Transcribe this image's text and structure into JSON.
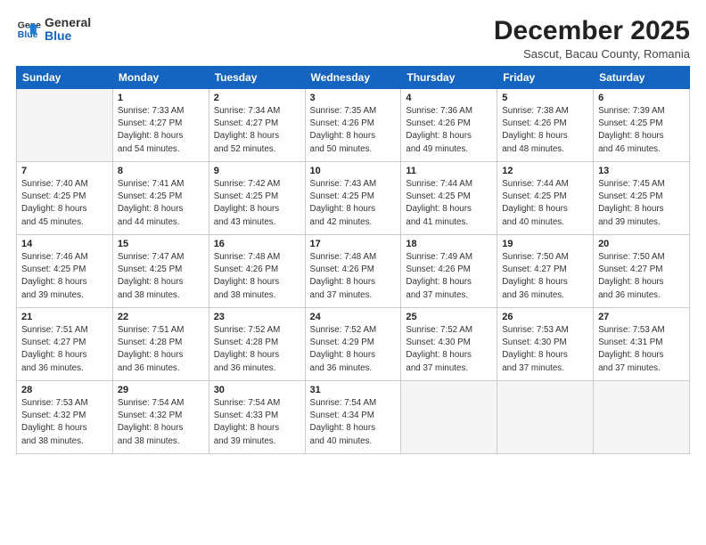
{
  "logo": {
    "line1": "General",
    "line2": "Blue"
  },
  "title": "December 2025",
  "subtitle": "Sascut, Bacau County, Romania",
  "weekdays": [
    "Sunday",
    "Monday",
    "Tuesday",
    "Wednesday",
    "Thursday",
    "Friday",
    "Saturday"
  ],
  "weeks": [
    [
      {
        "day": "",
        "info": ""
      },
      {
        "day": "1",
        "info": "Sunrise: 7:33 AM\nSunset: 4:27 PM\nDaylight: 8 hours\nand 54 minutes."
      },
      {
        "day": "2",
        "info": "Sunrise: 7:34 AM\nSunset: 4:27 PM\nDaylight: 8 hours\nand 52 minutes."
      },
      {
        "day": "3",
        "info": "Sunrise: 7:35 AM\nSunset: 4:26 PM\nDaylight: 8 hours\nand 50 minutes."
      },
      {
        "day": "4",
        "info": "Sunrise: 7:36 AM\nSunset: 4:26 PM\nDaylight: 8 hours\nand 49 minutes."
      },
      {
        "day": "5",
        "info": "Sunrise: 7:38 AM\nSunset: 4:26 PM\nDaylight: 8 hours\nand 48 minutes."
      },
      {
        "day": "6",
        "info": "Sunrise: 7:39 AM\nSunset: 4:25 PM\nDaylight: 8 hours\nand 46 minutes."
      }
    ],
    [
      {
        "day": "7",
        "info": "Sunrise: 7:40 AM\nSunset: 4:25 PM\nDaylight: 8 hours\nand 45 minutes."
      },
      {
        "day": "8",
        "info": "Sunrise: 7:41 AM\nSunset: 4:25 PM\nDaylight: 8 hours\nand 44 minutes."
      },
      {
        "day": "9",
        "info": "Sunrise: 7:42 AM\nSunset: 4:25 PM\nDaylight: 8 hours\nand 43 minutes."
      },
      {
        "day": "10",
        "info": "Sunrise: 7:43 AM\nSunset: 4:25 PM\nDaylight: 8 hours\nand 42 minutes."
      },
      {
        "day": "11",
        "info": "Sunrise: 7:44 AM\nSunset: 4:25 PM\nDaylight: 8 hours\nand 41 minutes."
      },
      {
        "day": "12",
        "info": "Sunrise: 7:44 AM\nSunset: 4:25 PM\nDaylight: 8 hours\nand 40 minutes."
      },
      {
        "day": "13",
        "info": "Sunrise: 7:45 AM\nSunset: 4:25 PM\nDaylight: 8 hours\nand 39 minutes."
      }
    ],
    [
      {
        "day": "14",
        "info": "Sunrise: 7:46 AM\nSunset: 4:25 PM\nDaylight: 8 hours\nand 39 minutes."
      },
      {
        "day": "15",
        "info": "Sunrise: 7:47 AM\nSunset: 4:25 PM\nDaylight: 8 hours\nand 38 minutes."
      },
      {
        "day": "16",
        "info": "Sunrise: 7:48 AM\nSunset: 4:26 PM\nDaylight: 8 hours\nand 38 minutes."
      },
      {
        "day": "17",
        "info": "Sunrise: 7:48 AM\nSunset: 4:26 PM\nDaylight: 8 hours\nand 37 minutes."
      },
      {
        "day": "18",
        "info": "Sunrise: 7:49 AM\nSunset: 4:26 PM\nDaylight: 8 hours\nand 37 minutes."
      },
      {
        "day": "19",
        "info": "Sunrise: 7:50 AM\nSunset: 4:27 PM\nDaylight: 8 hours\nand 36 minutes."
      },
      {
        "day": "20",
        "info": "Sunrise: 7:50 AM\nSunset: 4:27 PM\nDaylight: 8 hours\nand 36 minutes."
      }
    ],
    [
      {
        "day": "21",
        "info": "Sunrise: 7:51 AM\nSunset: 4:27 PM\nDaylight: 8 hours\nand 36 minutes."
      },
      {
        "day": "22",
        "info": "Sunrise: 7:51 AM\nSunset: 4:28 PM\nDaylight: 8 hours\nand 36 minutes."
      },
      {
        "day": "23",
        "info": "Sunrise: 7:52 AM\nSunset: 4:28 PM\nDaylight: 8 hours\nand 36 minutes."
      },
      {
        "day": "24",
        "info": "Sunrise: 7:52 AM\nSunset: 4:29 PM\nDaylight: 8 hours\nand 36 minutes."
      },
      {
        "day": "25",
        "info": "Sunrise: 7:52 AM\nSunset: 4:30 PM\nDaylight: 8 hours\nand 37 minutes."
      },
      {
        "day": "26",
        "info": "Sunrise: 7:53 AM\nSunset: 4:30 PM\nDaylight: 8 hours\nand 37 minutes."
      },
      {
        "day": "27",
        "info": "Sunrise: 7:53 AM\nSunset: 4:31 PM\nDaylight: 8 hours\nand 37 minutes."
      }
    ],
    [
      {
        "day": "28",
        "info": "Sunrise: 7:53 AM\nSunset: 4:32 PM\nDaylight: 8 hours\nand 38 minutes."
      },
      {
        "day": "29",
        "info": "Sunrise: 7:54 AM\nSunset: 4:32 PM\nDaylight: 8 hours\nand 38 minutes."
      },
      {
        "day": "30",
        "info": "Sunrise: 7:54 AM\nSunset: 4:33 PM\nDaylight: 8 hours\nand 39 minutes."
      },
      {
        "day": "31",
        "info": "Sunrise: 7:54 AM\nSunset: 4:34 PM\nDaylight: 8 hours\nand 40 minutes."
      },
      {
        "day": "",
        "info": ""
      },
      {
        "day": "",
        "info": ""
      },
      {
        "day": "",
        "info": ""
      }
    ]
  ]
}
